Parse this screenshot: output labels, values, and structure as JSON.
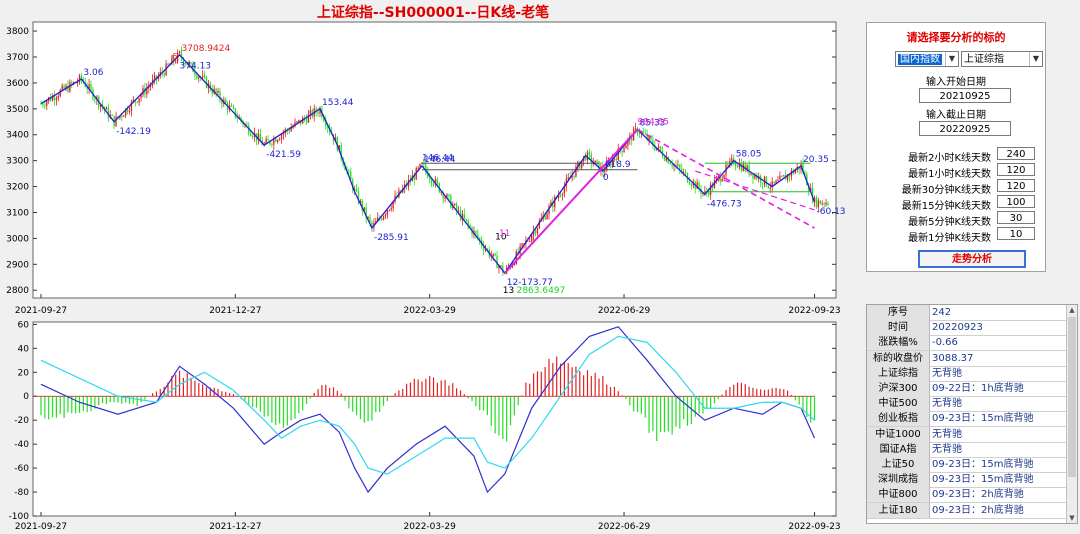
{
  "title": "上证综指--SH000001--日K线-老笔",
  "chart_data": [
    {
      "type": "candlestick",
      "x_ticks": [
        "2021-09-27",
        "2021-12-27",
        "2022-03-29",
        "2022-06-29",
        "2022-09-23"
      ],
      "y_ticks": [
        2800,
        2900,
        3000,
        3100,
        3200,
        3300,
        3400,
        3500,
        3600,
        3700,
        3800
      ],
      "ylim": [
        2770,
        3835
      ],
      "stroke_pivots": [
        {
          "x": 0,
          "y": 3520,
          "label": ""
        },
        {
          "x": 21,
          "y": 3615,
          "label": "3.06"
        },
        {
          "x": 38,
          "y": 3450,
          "label": "-142.19"
        },
        {
          "x": 72,
          "y": 3708,
          "label": "3708.9424"
        },
        {
          "x": 116,
          "y": 3360,
          "label": "-421.59"
        },
        {
          "x": 145,
          "y": 3500,
          "label": "153.44"
        },
        {
          "x": 154,
          "y": 3360,
          "label": ""
        },
        {
          "x": 163,
          "y": 3180,
          "label": ""
        },
        {
          "x": 172,
          "y": 3040,
          "label": "-285.91"
        },
        {
          "x": 198,
          "y": 3280,
          "label": "146.44"
        },
        {
          "x": 241,
          "y": 2866,
          "label": "12-173.77"
        },
        {
          "x": 283,
          "y": 3320,
          "label": ""
        },
        {
          "x": 292,
          "y": 3260,
          "label": "818.9"
        },
        {
          "x": 310,
          "y": 3420,
          "label": "85.33"
        },
        {
          "x": 345,
          "y": 3170,
          "label": "-476.73"
        },
        {
          "x": 360,
          "y": 3300,
          "label": "58.05"
        },
        {
          "x": 380,
          "y": 3200,
          "label": ""
        },
        {
          "x": 395,
          "y": 3280,
          "label": "20.35"
        },
        {
          "x": 402,
          "y": 3140,
          "label": "-60.13"
        }
      ],
      "annotations": [
        "3708.9424",
        "6",
        "374.13",
        "146.44",
        "994.85",
        "818.9",
        "85.33",
        "0",
        "13",
        "- 2863.6497",
        "10",
        "11"
      ]
    },
    {
      "type": "bar",
      "y_ticks": [
        60,
        40,
        20,
        0,
        -20,
        -40,
        -60,
        -80,
        -100
      ],
      "ylim": [
        -100,
        62
      ],
      "x_ticks": [
        "2021-09-27",
        "2021-12-27",
        "2022-03-29",
        "2022-06-29",
        "2022-09-23"
      ],
      "macd_envelope": [
        {
          "x": 0,
          "v": -20
        },
        {
          "x": 20,
          "v": -15
        },
        {
          "x": 35,
          "v": -5
        },
        {
          "x": 50,
          "v": -8
        },
        {
          "x": 60,
          "v": 5
        },
        {
          "x": 72,
          "v": 20
        },
        {
          "x": 85,
          "v": 10
        },
        {
          "x": 100,
          "v": 2
        },
        {
          "x": 112,
          "v": -10
        },
        {
          "x": 125,
          "v": -30
        },
        {
          "x": 135,
          "v": -15
        },
        {
          "x": 145,
          "v": 10
        },
        {
          "x": 155,
          "v": 5
        },
        {
          "x": 162,
          "v": -15
        },
        {
          "x": 170,
          "v": -25
        },
        {
          "x": 185,
          "v": 5
        },
        {
          "x": 200,
          "v": 18
        },
        {
          "x": 215,
          "v": 10
        },
        {
          "x": 230,
          "v": -15
        },
        {
          "x": 241,
          "v": -40
        },
        {
          "x": 252,
          "v": 10
        },
        {
          "x": 265,
          "v": 35
        },
        {
          "x": 280,
          "v": 25
        },
        {
          "x": 292,
          "v": 15
        },
        {
          "x": 300,
          "v": 5
        },
        {
          "x": 310,
          "v": -15
        },
        {
          "x": 320,
          "v": -35
        },
        {
          "x": 332,
          "v": -25
        },
        {
          "x": 345,
          "v": -15
        },
        {
          "x": 360,
          "v": 12
        },
        {
          "x": 375,
          "v": 5
        },
        {
          "x": 387,
          "v": 8
        },
        {
          "x": 395,
          "v": -10
        },
        {
          "x": 402,
          "v": -25
        }
      ],
      "series": [
        {
          "color": "#3030d0",
          "points": [
            [
              0,
              10
            ],
            [
              20,
              -5
            ],
            [
              40,
              -15
            ],
            [
              60,
              -5
            ],
            [
              72,
              25
            ],
            [
              85,
              10
            ],
            [
              100,
              -10
            ],
            [
              116,
              -40
            ],
            [
              125,
              -30
            ],
            [
              135,
              -20
            ],
            [
              145,
              -15
            ],
            [
              155,
              -30
            ],
            [
              163,
              -60
            ],
            [
              170,
              -80
            ],
            [
              180,
              -60
            ],
            [
              195,
              -40
            ],
            [
              210,
              -25
            ],
            [
              225,
              -50
            ],
            [
              232,
              -80
            ],
            [
              241,
              -65
            ],
            [
              255,
              -10
            ],
            [
              270,
              25
            ],
            [
              285,
              50
            ],
            [
              300,
              58
            ],
            [
              315,
              30
            ],
            [
              330,
              0
            ],
            [
              345,
              -20
            ],
            [
              360,
              -10
            ],
            [
              375,
              -15
            ],
            [
              385,
              -5
            ],
            [
              395,
              -10
            ],
            [
              402,
              -35
            ]
          ]
        },
        {
          "color": "#30d8f0",
          "points": [
            [
              0,
              30
            ],
            [
              20,
              15
            ],
            [
              40,
              0
            ],
            [
              60,
              -5
            ],
            [
              72,
              10
            ],
            [
              85,
              20
            ],
            [
              100,
              5
            ],
            [
              116,
              -20
            ],
            [
              125,
              -35
            ],
            [
              135,
              -25
            ],
            [
              145,
              -20
            ],
            [
              155,
              -25
            ],
            [
              163,
              -40
            ],
            [
              170,
              -60
            ],
            [
              180,
              -65
            ],
            [
              195,
              -50
            ],
            [
              210,
              -35
            ],
            [
              225,
              -35
            ],
            [
              232,
              -55
            ],
            [
              241,
              -60
            ],
            [
              255,
              -35
            ],
            [
              270,
              0
            ],
            [
              285,
              35
            ],
            [
              300,
              50
            ],
            [
              315,
              45
            ],
            [
              330,
              20
            ],
            [
              345,
              -10
            ],
            [
              360,
              -10
            ],
            [
              375,
              -5
            ],
            [
              385,
              -5
            ],
            [
              395,
              -10
            ],
            [
              402,
              -20
            ]
          ]
        }
      ]
    }
  ],
  "panel": {
    "title": "请选择要分析的标的",
    "market_value": "国内指数",
    "index_value": "上证综指",
    "start_label": "输入开始日期",
    "start_value": "20210925",
    "end_label": "输入截止日期",
    "end_value": "20220925",
    "params": [
      {
        "label": "最新2小时K线天数",
        "value": "240"
      },
      {
        "label": "最新1小时K线天数",
        "value": "120"
      },
      {
        "label": "最新30分钟K线天数",
        "value": "120"
      },
      {
        "label": "最新15分钟K线天数",
        "value": "100"
      },
      {
        "label": "最新5分钟K线天数",
        "value": "30"
      },
      {
        "label": "最新1分钟K线天数",
        "value": "10"
      }
    ],
    "button": "走势分析"
  },
  "table": [
    {
      "k": "序号",
      "v": "242"
    },
    {
      "k": "时间",
      "v": "20220923"
    },
    {
      "k": "涨跌幅%",
      "v": "-0.66"
    },
    {
      "k": "标的收盘价",
      "v": "3088.37"
    },
    {
      "k": "上证综指",
      "v": "无背驰"
    },
    {
      "k": "沪深300",
      "v": "09-22日：1h底背驰"
    },
    {
      "k": "中证500",
      "v": "无背驰"
    },
    {
      "k": "创业板指",
      "v": "09-23日：15m底背驰"
    },
    {
      "k": "中证1000",
      "v": "无背驰"
    },
    {
      "k": "国证A指",
      "v": "无背驰"
    },
    {
      "k": "上证50",
      "v": "09-23日：15m底背驰"
    },
    {
      "k": "深圳成指",
      "v": "09-23日：15m底背驰"
    },
    {
      "k": "中证800",
      "v": "09-23日：2h底背驰"
    },
    {
      "k": "上证180",
      "v": "09-23日：2h底背驰"
    }
  ],
  "colors": {
    "up": "#e02020",
    "down": "#20e020",
    "stroke": "#2020d0",
    "magenta": "#e020e0",
    "label_blue": "#2020d0"
  }
}
